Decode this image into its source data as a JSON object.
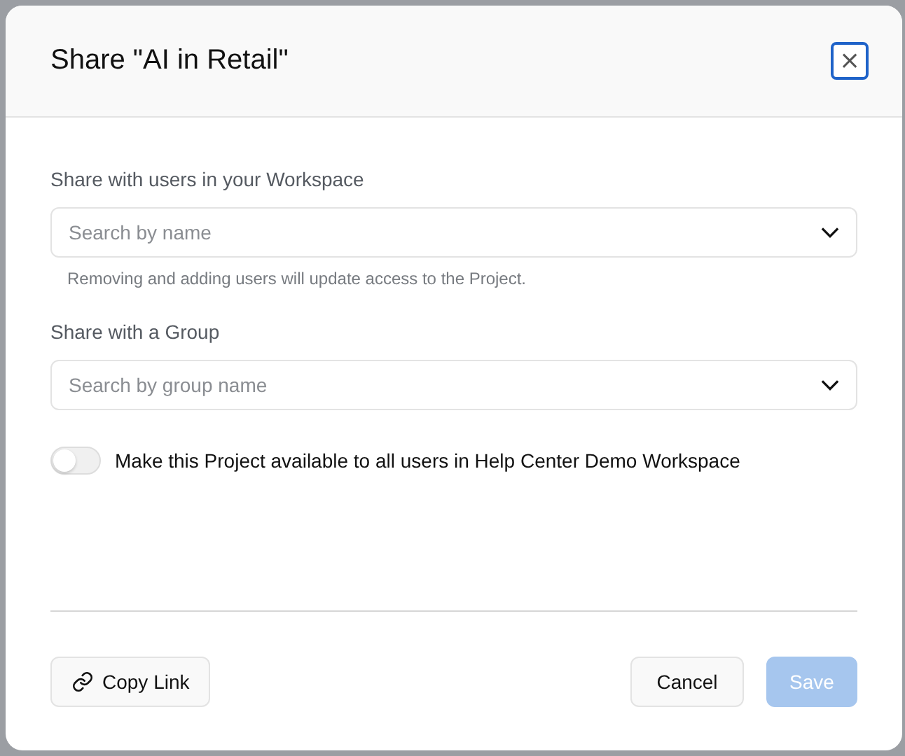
{
  "dialog": {
    "title": "Share \"AI in Retail\"",
    "close_label": "×"
  },
  "users": {
    "label": "Share with users in your Workspace",
    "placeholder": "Search by name",
    "hint": "Removing and adding users will update access to the Project."
  },
  "group": {
    "label": "Share with a Group",
    "placeholder": "Search by group name"
  },
  "workspace_toggle": {
    "label": "Make this Project available to all users in Help Center Demo Workspace",
    "on": false
  },
  "buttons": [
    {
      "kind": "link",
      "label": "Copy Link"
    },
    {
      "kind": "secondary",
      "label": "Cancel"
    },
    {
      "kind": "primary",
      "label": "Save",
      "disabled": true
    }
  ]
}
